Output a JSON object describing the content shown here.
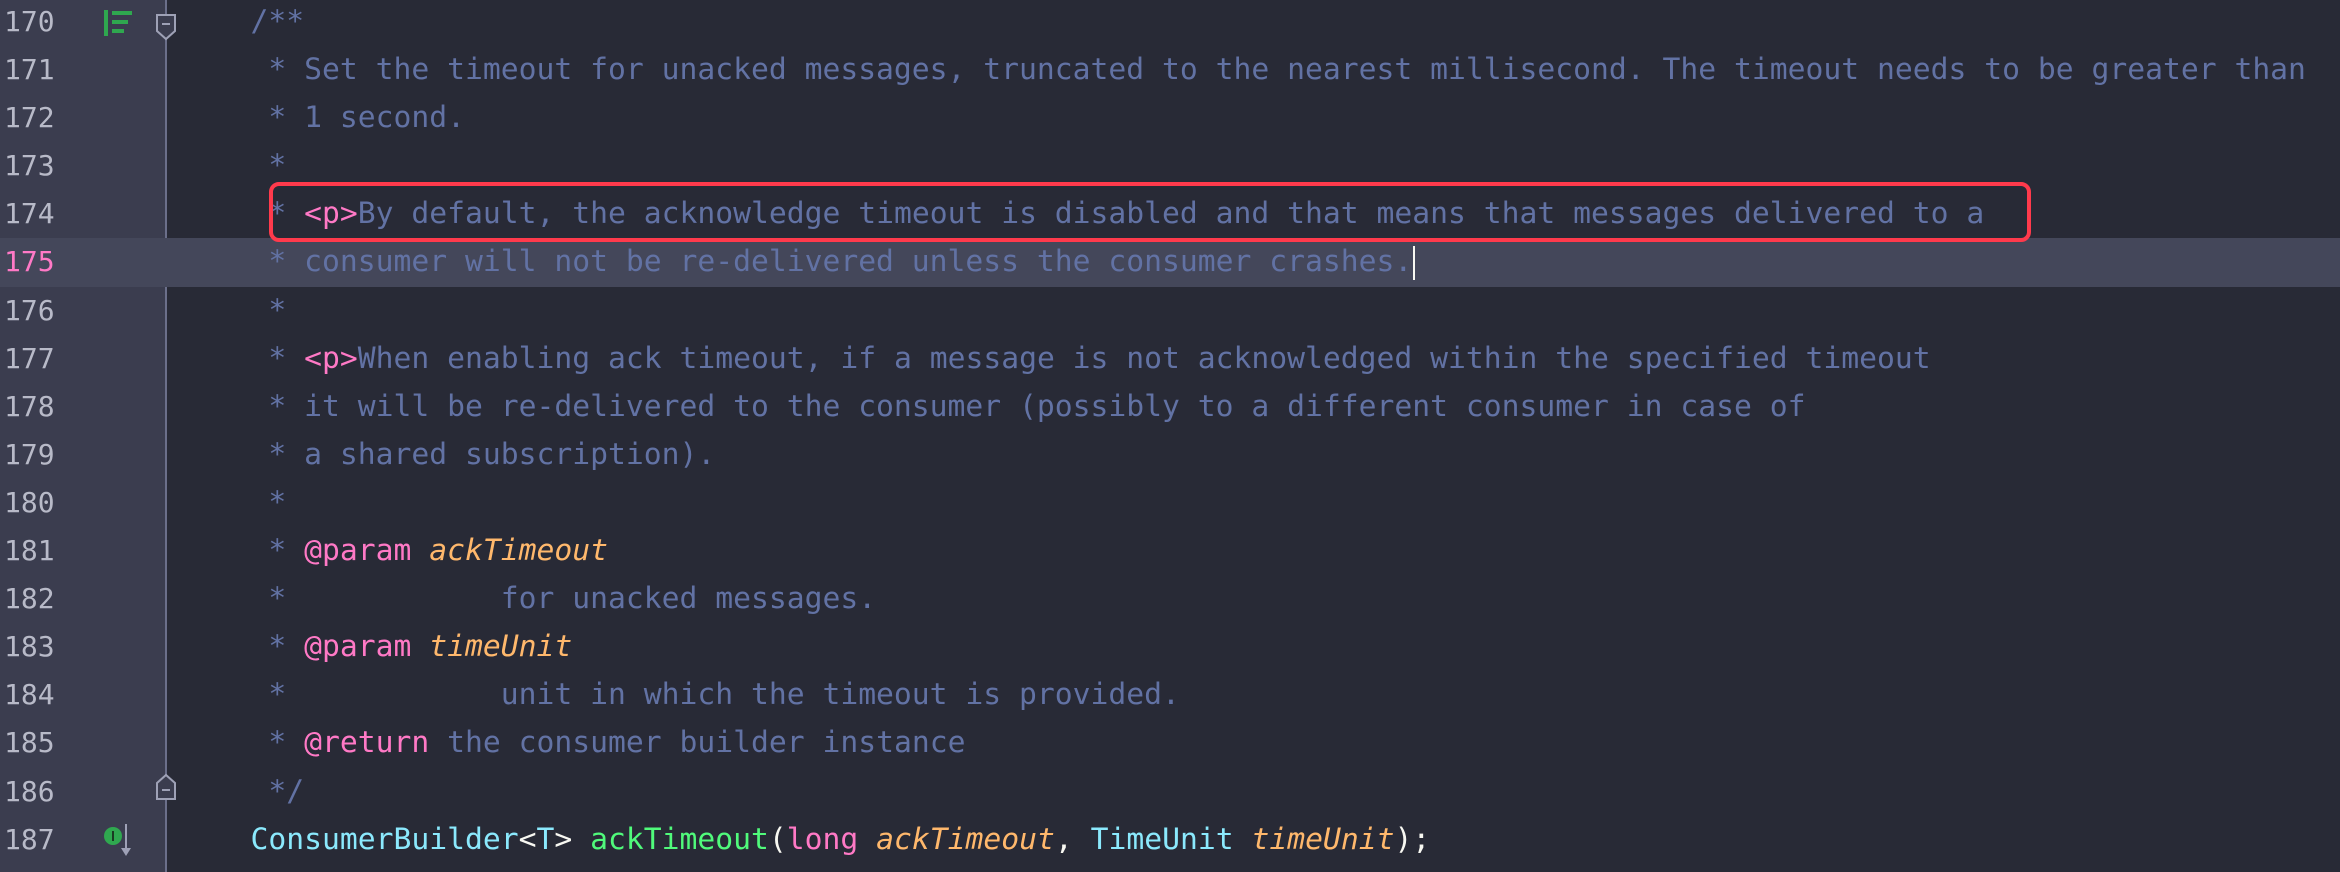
{
  "editor": {
    "current_line": 175,
    "colors": {
      "background": "#282a36",
      "gutter": "#3b3d4f",
      "current_line": "#44475a",
      "comment": "#6272a4",
      "tag": "#ff79c6",
      "type": "#8be9fd",
      "function": "#50fa7b",
      "param": "#ffb86c",
      "highlight_box": "#ff3a4c"
    },
    "gutter_icons": [
      {
        "line": 170,
        "icon": "structure-icon"
      },
      {
        "line": 170,
        "icon": "fold-collapse-icon"
      },
      {
        "line": 186,
        "icon": "fold-end-icon"
      },
      {
        "line": 187,
        "icon": "implemented-interface-down-icon"
      }
    ],
    "lines": [
      {
        "n": "170",
        "tokens": [
          {
            "c": "comment",
            "t": "    /**"
          }
        ]
      },
      {
        "n": "171",
        "tokens": [
          {
            "c": "comment",
            "t": "     * Set the timeout for unacked messages, truncated to the nearest millisecond. The timeout needs to be greater than"
          }
        ]
      },
      {
        "n": "172",
        "tokens": [
          {
            "c": "comment",
            "t": "     * 1 second."
          }
        ]
      },
      {
        "n": "173",
        "tokens": [
          {
            "c": "comment",
            "t": "     *"
          }
        ]
      },
      {
        "n": "174",
        "tokens": [
          {
            "c": "comment",
            "t": "     * "
          },
          {
            "c": "tag",
            "t": "<p>"
          },
          {
            "c": "comment",
            "t": "By default, the acknowledge timeout is disabled and that means that messages delivered to a"
          }
        ]
      },
      {
        "n": "175",
        "tokens": [
          {
            "c": "comment",
            "t": "     * consumer will not be re-delivered unless the consumer crashes."
          }
        ]
      },
      {
        "n": "176",
        "tokens": [
          {
            "c": "comment",
            "t": "     *"
          }
        ]
      },
      {
        "n": "177",
        "tokens": [
          {
            "c": "comment",
            "t": "     * "
          },
          {
            "c": "tag",
            "t": "<p>"
          },
          {
            "c": "comment",
            "t": "When enabling ack timeout, if a message is not acknowledged within the specified timeout"
          }
        ]
      },
      {
        "n": "178",
        "tokens": [
          {
            "c": "comment",
            "t": "     * it will be re-delivered to the consumer (possibly to a different consumer in case of"
          }
        ]
      },
      {
        "n": "179",
        "tokens": [
          {
            "c": "comment",
            "t": "     * a shared subscription)."
          }
        ]
      },
      {
        "n": "180",
        "tokens": [
          {
            "c": "comment",
            "t": "     *"
          }
        ]
      },
      {
        "n": "181",
        "tokens": [
          {
            "c": "comment",
            "t": "     * "
          },
          {
            "c": "tag",
            "t": "@param"
          },
          {
            "c": "comment",
            "t": " "
          },
          {
            "c": "param",
            "t": "ackTimeout"
          }
        ]
      },
      {
        "n": "182",
        "tokens": [
          {
            "c": "comment",
            "t": "     *            for unacked messages."
          }
        ]
      },
      {
        "n": "183",
        "tokens": [
          {
            "c": "comment",
            "t": "     * "
          },
          {
            "c": "tag",
            "t": "@param"
          },
          {
            "c": "comment",
            "t": " "
          },
          {
            "c": "param",
            "t": "timeUnit"
          }
        ]
      },
      {
        "n": "184",
        "tokens": [
          {
            "c": "comment",
            "t": "     *            unit in which the timeout is provided."
          }
        ]
      },
      {
        "n": "185",
        "tokens": [
          {
            "c": "comment",
            "t": "     * "
          },
          {
            "c": "tag",
            "t": "@return"
          },
          {
            "c": "comment",
            "t": " the consumer builder instance"
          }
        ]
      },
      {
        "n": "186",
        "tokens": [
          {
            "c": "comment",
            "t": "     */"
          }
        ]
      },
      {
        "n": "187",
        "tokens": [
          {
            "c": "plain",
            "t": "    "
          },
          {
            "c": "type",
            "t": "ConsumerBuilder"
          },
          {
            "c": "plain",
            "t": "<"
          },
          {
            "c": "type",
            "t": "T"
          },
          {
            "c": "plain",
            "t": "> "
          },
          {
            "c": "fn",
            "t": "ackTimeout"
          },
          {
            "c": "plain",
            "t": "("
          },
          {
            "c": "kw",
            "t": "long"
          },
          {
            "c": "plain",
            "t": " "
          },
          {
            "c": "param",
            "t": "ackTimeout"
          },
          {
            "c": "plain",
            "t": ", "
          },
          {
            "c": "type",
            "t": "TimeUnit"
          },
          {
            "c": "plain",
            "t": " "
          },
          {
            "c": "param",
            "t": "timeUnit"
          },
          {
            "c": "plain",
            "t": ");"
          }
        ]
      }
    ]
  }
}
